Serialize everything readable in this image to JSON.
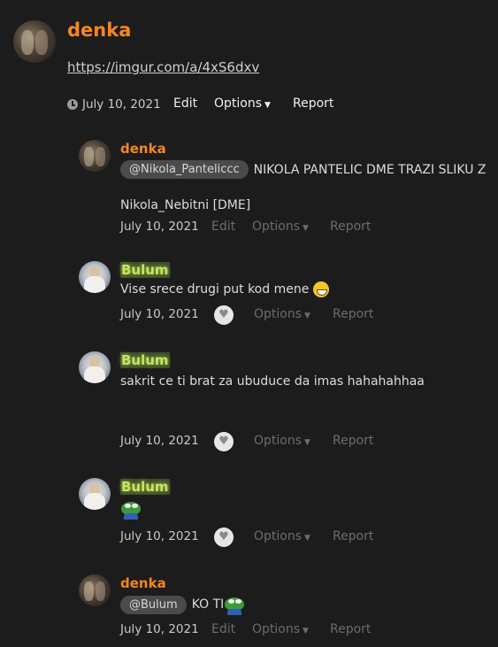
{
  "main_post": {
    "author": "denka",
    "link": "https://imgur.com/a/4xS6dxv",
    "date": "July 10, 2021",
    "actions": {
      "edit": "Edit",
      "options": "Options",
      "report": "Report"
    }
  },
  "replies": [
    {
      "author": "denka",
      "mention": "@Nikola_Panteliccc",
      "text": "NIKOLA PANTELIC DME TRAZI SLIKU Z",
      "text2": "Nikola_Nebitni [DME]",
      "date": "July 10, 2021",
      "actions": {
        "edit": "Edit",
        "options": "Options",
        "report": "Report"
      }
    },
    {
      "author": "Bulum",
      "text": "Vise srece drugi put kod mene",
      "date": "July 10, 2021",
      "actions": {
        "options": "Options",
        "report": "Report"
      }
    },
    {
      "author": "Bulum",
      "text": "sakrit ce ti brat za ubuduce da imas hahahahhaa",
      "date": "July 10, 2021",
      "actions": {
        "options": "Options",
        "report": "Report"
      }
    },
    {
      "author": "Bulum",
      "date": "July 10, 2021",
      "actions": {
        "options": "Options",
        "report": "Report"
      }
    },
    {
      "author": "denka",
      "mention": "@Bulum",
      "text": "KO TI",
      "date": "July 10, 2021",
      "actions": {
        "edit": "Edit",
        "options": "Options",
        "report": "Report"
      }
    }
  ]
}
